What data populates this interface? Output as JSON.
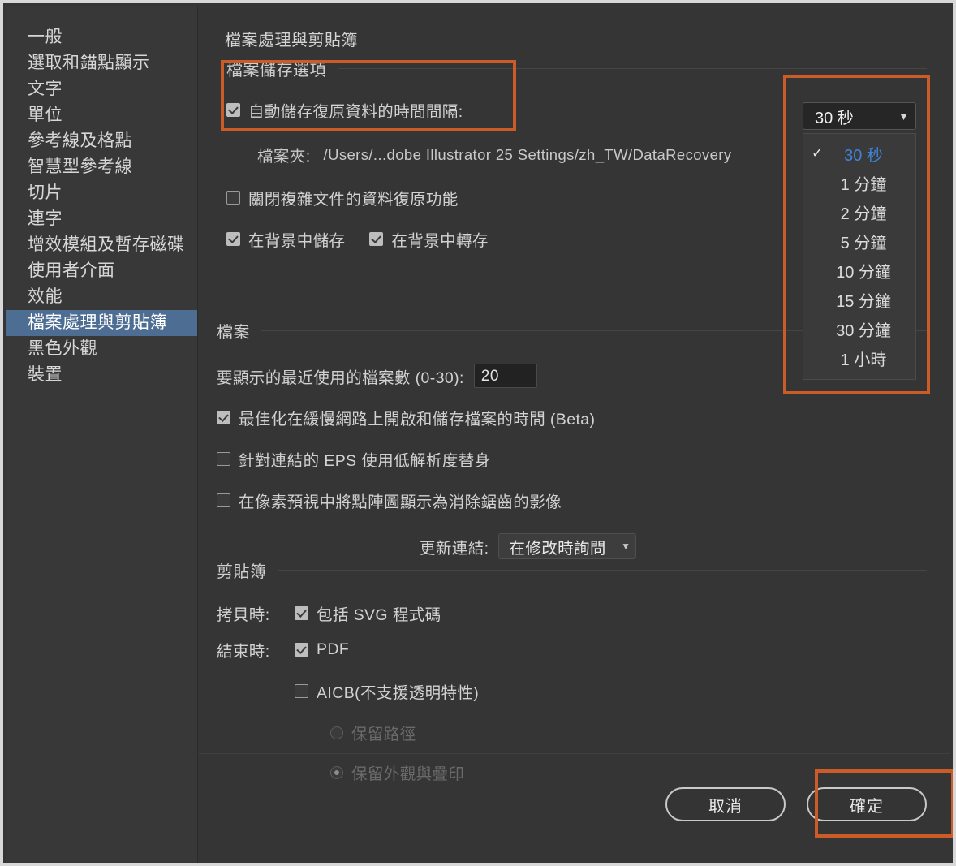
{
  "window": {
    "panel_title": "檔案處理與剪貼簿"
  },
  "sidebar": {
    "items": [
      {
        "label": "一般",
        "selected": false
      },
      {
        "label": "選取和錨點顯示",
        "selected": false
      },
      {
        "label": "文字",
        "selected": false
      },
      {
        "label": "單位",
        "selected": false
      },
      {
        "label": "參考線及格點",
        "selected": false
      },
      {
        "label": "智慧型參考線",
        "selected": false
      },
      {
        "label": "切片",
        "selected": false
      },
      {
        "label": "連字",
        "selected": false
      },
      {
        "label": "增效模組及暫存磁碟",
        "selected": false
      },
      {
        "label": "使用者介面",
        "selected": false
      },
      {
        "label": "效能",
        "selected": false
      },
      {
        "label": "檔案處理與剪貼簿",
        "selected": true
      },
      {
        "label": "黑色外觀",
        "selected": false
      },
      {
        "label": "裝置",
        "selected": false
      }
    ]
  },
  "file_save_options": {
    "heading": "檔案儲存選項",
    "auto_save_label": "自動儲存復原資料的時間間隔:",
    "auto_save_checked": true,
    "folder_label": "檔案夾:",
    "folder_path": "/Users/...dobe Illustrator 25 Settings/zh_TW/DataRecovery",
    "turn_off_recovery_label": "關閉複雜文件的資料復原功能",
    "turn_off_recovery_checked": false,
    "save_in_background_label": "在背景中儲存",
    "save_in_background_checked": true,
    "export_in_background_label": "在背景中轉存",
    "export_in_background_checked": true
  },
  "interval_dropdown": {
    "selected_value": "30 秒",
    "caret_icon": "chevron-down-icon",
    "check_icon": "check-mark-icon",
    "options": [
      {
        "label": "30 秒",
        "selected": true
      },
      {
        "label": "1 分鐘",
        "selected": false
      },
      {
        "label": "2 分鐘",
        "selected": false
      },
      {
        "label": "5 分鐘",
        "selected": false
      },
      {
        "label": "10 分鐘",
        "selected": false
      },
      {
        "label": "15 分鐘",
        "selected": false
      },
      {
        "label": "30 分鐘",
        "selected": false
      },
      {
        "label": "1 小時",
        "selected": false
      }
    ]
  },
  "files_section": {
    "heading": "檔案",
    "recent_files_label": "要顯示的最近使用的檔案數 (0-30):",
    "recent_files_value": "20",
    "optimize_label": "最佳化在緩慢網路上開啟和儲存檔案的時間 (Beta)",
    "optimize_checked": true,
    "eps_proxy_label": "針對連結的 EPS 使用低解析度替身",
    "eps_proxy_checked": false,
    "antialias_label": "在像素預視中將點陣圖顯示為消除鋸齒的影像",
    "antialias_checked": false,
    "update_links_label": "更新連結:",
    "update_links_value": "在修改時詢問",
    "update_links_caret": "chevron-down-icon"
  },
  "clipboard_section": {
    "heading": "剪貼簿",
    "on_copy_label": "拷貝時:",
    "include_svg_label": "包括 SVG 程式碼",
    "include_svg_checked": true,
    "on_quit_label": "結束時:",
    "pdf_label": "PDF",
    "pdf_checked": true,
    "aicb_label": "AICB(不支援透明特性)",
    "aicb_checked": false,
    "preserve_paths_label": "保留路徑",
    "preserve_paths_selected": false,
    "preserve_appearance_label": "保留外觀與疊印",
    "preserve_appearance_selected": true
  },
  "footer": {
    "cancel_label": "取消",
    "ok_label": "確定"
  },
  "colors": {
    "highlight": "#cc5c27",
    "selection": "#4e6d93",
    "dropdown_selected_text": "#3f83d8",
    "panel_bg": "#353535",
    "sidebar_bg": "#383838"
  }
}
